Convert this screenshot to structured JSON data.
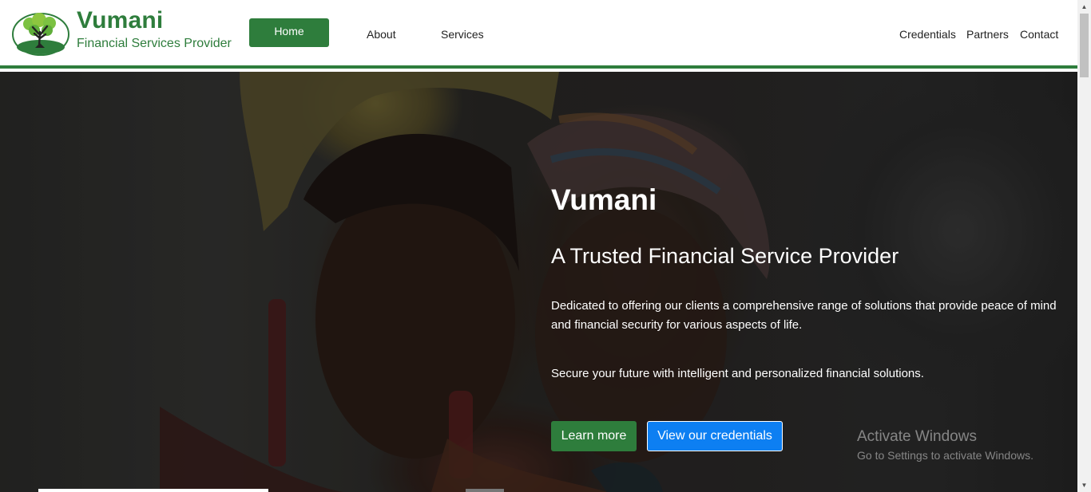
{
  "header": {
    "brand_title": "Vumani",
    "brand_subtitle": "Financial Services Provider",
    "logo_icon": "tree-logo-icon",
    "nav": {
      "home": "Home",
      "about": "About",
      "services": "Services",
      "credentials": "Credentials",
      "partners": "Partners",
      "contact": "Contact"
    }
  },
  "hero": {
    "title": "Vumani",
    "subtitle": "A Trusted Financial Service Provider",
    "description": "Dedicated to offering our clients a comprehensive range of solutions that provide peace of mind and financial security for various aspects of life.",
    "tagline": "Secure your future with intelligent and personalized financial solutions.",
    "learn_more": "Learn more",
    "view_credentials": "View our credentials"
  },
  "watermark": {
    "title": "Activate Windows",
    "subtitle": "Go to Settings to activate Windows."
  },
  "colors": {
    "brand_green": "#2e7d3c",
    "button_blue": "#0d7ff2"
  }
}
